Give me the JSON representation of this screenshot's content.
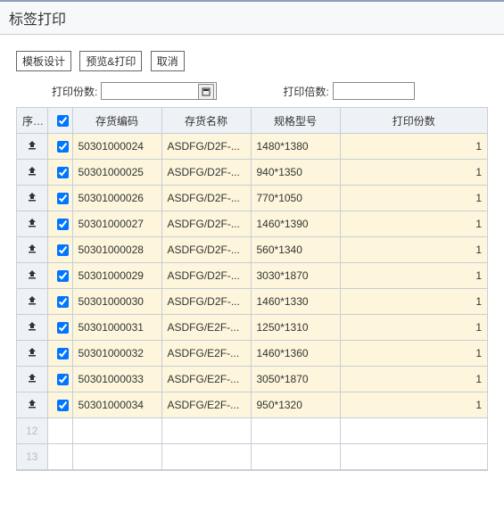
{
  "title": "标签打印",
  "buttons": {
    "template": "模板设计",
    "preview": "预览&打印",
    "cancel": "取消"
  },
  "form": {
    "copies_label": "打印份数:",
    "copies_value": "",
    "multiplier_label": "打印倍数:",
    "multiplier_value": ""
  },
  "columns": {
    "index": "序号",
    "code": "存货编码",
    "name": "存货名称",
    "spec": "规格型号",
    "qty": "打印份数"
  },
  "rows": [
    {
      "checked": true,
      "code": "50301000024",
      "name": "ASDFG/D2F-...",
      "spec": "1480*1380",
      "qty": 1
    },
    {
      "checked": true,
      "code": "50301000025",
      "name": "ASDFG/D2F-...",
      "spec": "940*1350",
      "qty": 1
    },
    {
      "checked": true,
      "code": "50301000026",
      "name": "ASDFG/D2F-...",
      "spec": "770*1050",
      "qty": 1
    },
    {
      "checked": true,
      "code": "50301000027",
      "name": "ASDFG/D2F-...",
      "spec": "1460*1390",
      "qty": 1
    },
    {
      "checked": true,
      "code": "50301000028",
      "name": "ASDFG/D2F-...",
      "spec": "560*1340",
      "qty": 1
    },
    {
      "checked": true,
      "code": "50301000029",
      "name": "ASDFG/D2F-...",
      "spec": "3030*1870",
      "qty": 1
    },
    {
      "checked": true,
      "code": "50301000030",
      "name": "ASDFG/D2F-...",
      "spec": "1460*1330",
      "qty": 1
    },
    {
      "checked": true,
      "code": "50301000031",
      "name": "ASDFG/E2F-...",
      "spec": "1250*1310",
      "qty": 1
    },
    {
      "checked": true,
      "code": "50301000032",
      "name": "ASDFG/E2F-...",
      "spec": "1460*1360",
      "qty": 1
    },
    {
      "checked": true,
      "code": "50301000033",
      "name": "ASDFG/E2F-...",
      "spec": "3050*1870",
      "qty": 1
    },
    {
      "checked": true,
      "code": "50301000034",
      "name": "ASDFG/E2F-...",
      "spec": "950*1320",
      "qty": 1
    }
  ],
  "empty_rows": [
    "12",
    "13"
  ],
  "header_checked": true
}
